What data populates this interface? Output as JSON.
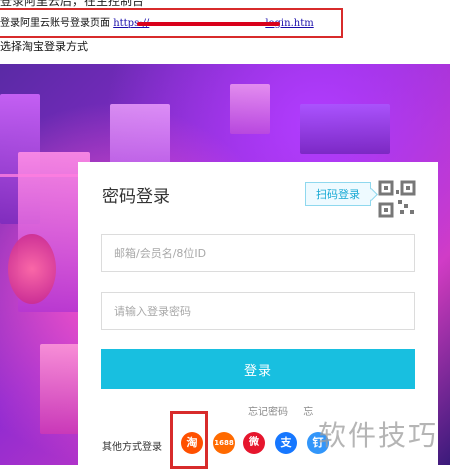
{
  "document": {
    "partial_line": "登录阿里云后，在主控制台",
    "step1_text": "登录阿里云账号登录页面",
    "step1_link_prefix": "https://",
    "step1_link_suffix": "login.htm",
    "step2_text": "选择淘宝登录方式"
  },
  "login": {
    "title": "密码登录",
    "qr_tip": "扫码登录",
    "account_placeholder": "邮箱/会员名/8位ID",
    "password_placeholder": "请输入登录密码",
    "submit_label": "登录",
    "forgot_password": "忘记密码",
    "forgot_member": "忘",
    "other_methods_label": "其他方式登录",
    "sns": [
      {
        "name": "taobao",
        "glyph": "淘",
        "color": "#ff5000"
      },
      {
        "name": "1688",
        "glyph": "1688",
        "color": "#ff6a00"
      },
      {
        "name": "weibo",
        "glyph": "微",
        "color": "#e6162d"
      },
      {
        "name": "alipay",
        "glyph": "支",
        "color": "#1677ff"
      },
      {
        "name": "dingtalk",
        "glyph": "钉",
        "color": "#3296fa"
      }
    ]
  },
  "watermark": "软件技巧",
  "colors": {
    "accent": "#18bfe0",
    "annotation_red": "#d82b2b"
  }
}
